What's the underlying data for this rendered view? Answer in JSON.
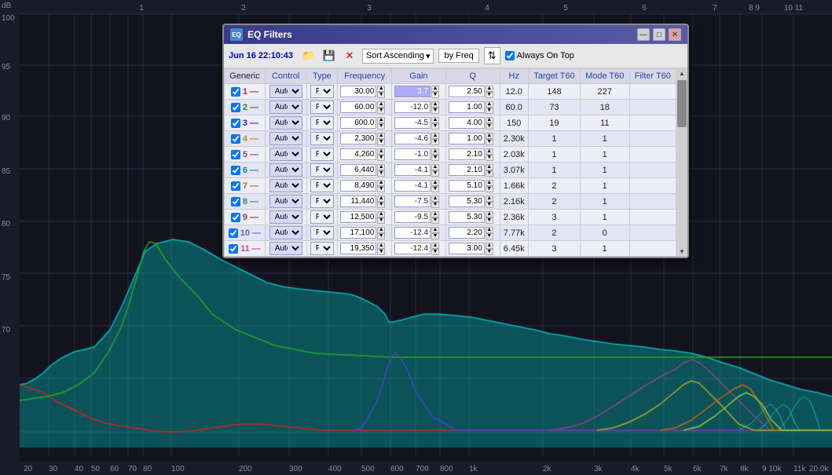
{
  "chart": {
    "bg": "#0d1117",
    "grid_color": "rgba(100,100,150,0.3)",
    "db_labels": [
      "100",
      "95",
      "90",
      "85",
      "80",
      "75",
      "70"
    ],
    "freq_labels": [
      "20",
      "30",
      "40",
      "50",
      "60",
      "70",
      "80",
      "100",
      "200",
      "300",
      "400",
      "500",
      "600",
      "700",
      "800",
      "1k",
      "2k",
      "3k",
      "4k",
      "5k",
      "6k",
      "7k",
      "8k",
      "9 10",
      "11",
      "20.0k"
    ],
    "top_freq_labels": [
      "1",
      "2",
      "3",
      "4",
      "5",
      "6",
      "7",
      "8 9",
      "10 11"
    ]
  },
  "dialog": {
    "title": "EQ Filters",
    "min_label": "—",
    "max_label": "□",
    "close_label": "✕",
    "toolbar": {
      "date": "Jun 16 22:10:43",
      "sort_label": "Sort Ascending",
      "by_freq_label": "by Freq",
      "always_on_top_label": "Always On Top",
      "always_on_top_checked": true
    },
    "table": {
      "headers": [
        "Generic",
        "Control",
        "Type",
        "Frequency",
        "Gain",
        "Q",
        "Hz",
        "Target T60",
        "Mode T60",
        "Filter T60"
      ],
      "rows": [
        {
          "num": 1,
          "enabled": true,
          "control": "Auto",
          "type": "PK",
          "frequency": "30.00",
          "gain": "3.7",
          "gain_highlighted": true,
          "q": "2.50",
          "hz": "12.0",
          "target_t60": "148",
          "mode_t60": "227",
          "filter_t60": ""
        },
        {
          "num": 2,
          "enabled": true,
          "control": "Auto",
          "type": "PK",
          "frequency": "60.00",
          "gain": "-12.0",
          "gain_highlighted": false,
          "q": "1.00",
          "hz": "60.0",
          "target_t60": "73",
          "mode_t60": "18",
          "filter_t60": ""
        },
        {
          "num": 3,
          "enabled": true,
          "control": "Auto",
          "type": "PK",
          "frequency": "600.0",
          "gain": "-4.5",
          "gain_highlighted": false,
          "q": "4.00",
          "hz": "150",
          "target_t60": "19",
          "mode_t60": "11",
          "filter_t60": ""
        },
        {
          "num": 4,
          "enabled": true,
          "control": "Auto",
          "type": "PK",
          "frequency": "2,300",
          "gain": "-4.6",
          "gain_highlighted": false,
          "q": "1.00",
          "hz": "2.30k",
          "target_t60": "1",
          "mode_t60": "1",
          "filter_t60": ""
        },
        {
          "num": 5,
          "enabled": true,
          "control": "Auto",
          "type": "PK",
          "frequency": "4,260",
          "gain": "-1.0",
          "gain_highlighted": false,
          "q": "2.10",
          "hz": "2.03k",
          "target_t60": "1",
          "mode_t60": "1",
          "filter_t60": ""
        },
        {
          "num": 6,
          "enabled": true,
          "control": "Auto",
          "type": "PK",
          "frequency": "6,440",
          "gain": "-4.1",
          "gain_highlighted": false,
          "q": "2.10",
          "hz": "3.07k",
          "target_t60": "1",
          "mode_t60": "1",
          "filter_t60": ""
        },
        {
          "num": 7,
          "enabled": true,
          "control": "Auto",
          "type": "PK",
          "frequency": "8,490",
          "gain": "-4.1",
          "gain_highlighted": false,
          "q": "5.10",
          "hz": "1.66k",
          "target_t60": "2",
          "mode_t60": "1",
          "filter_t60": ""
        },
        {
          "num": 8,
          "enabled": true,
          "control": "Auto",
          "type": "PK",
          "frequency": "11,440",
          "gain": "-7.5",
          "gain_highlighted": false,
          "q": "5.30",
          "hz": "2.16k",
          "target_t60": "2",
          "mode_t60": "1",
          "filter_t60": ""
        },
        {
          "num": 9,
          "enabled": true,
          "control": "Auto",
          "type": "PK",
          "frequency": "12,500",
          "gain": "-9.5",
          "gain_highlighted": false,
          "q": "5.30",
          "hz": "2.36k",
          "target_t60": "3",
          "mode_t60": "1",
          "filter_t60": ""
        },
        {
          "num": 10,
          "enabled": true,
          "control": "Auto",
          "type": "PK",
          "frequency": "17,100",
          "gain": "-12.4",
          "gain_highlighted": false,
          "q": "2.20",
          "hz": "7.77k",
          "target_t60": "2",
          "mode_t60": "0",
          "filter_t60": ""
        },
        {
          "num": 11,
          "enabled": true,
          "control": "Auto",
          "type": "PK",
          "frequency": "19,350",
          "gain": "-12.4",
          "gain_highlighted": false,
          "q": "3.00",
          "hz": "6.45k",
          "target_t60": "3",
          "mode_t60": "1",
          "filter_t60": ""
        }
      ]
    }
  }
}
